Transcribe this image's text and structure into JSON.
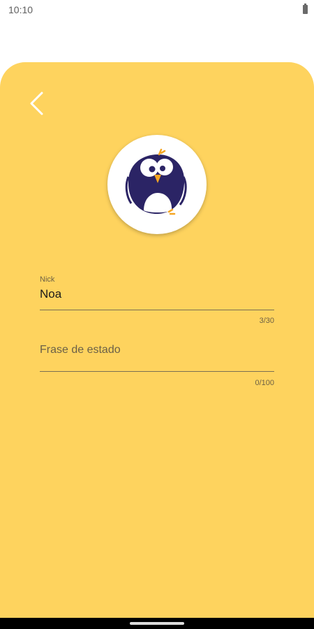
{
  "status_bar": {
    "time": "10:10",
    "battery_icon": "battery-full-icon"
  },
  "colors": {
    "card_background": "#fed35e",
    "avatar_body": "#2b2465"
  },
  "header": {
    "back_icon": "chevron-left-icon"
  },
  "avatar": {
    "icon": "penguin-bird-avatar"
  },
  "form": {
    "nick": {
      "label": "Nick",
      "value": "Noa",
      "counter": "3/30"
    },
    "status_phrase": {
      "placeholder": "Frase de estado",
      "value": "",
      "counter": "0/100"
    }
  }
}
